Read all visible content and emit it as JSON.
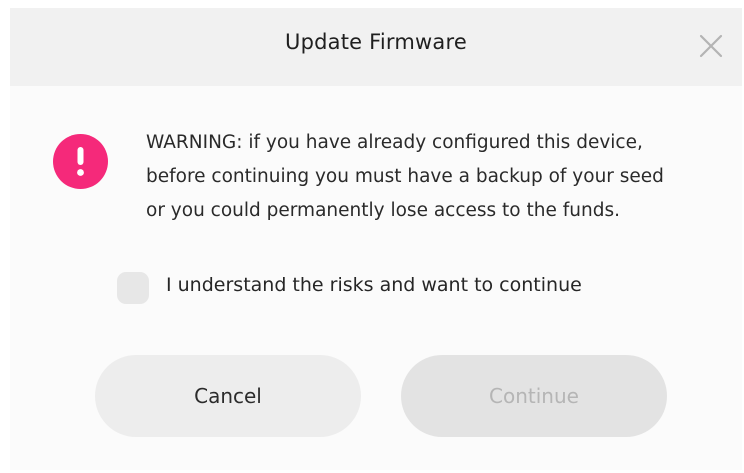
{
  "dialog": {
    "title": "Update Firmware",
    "close_icon": "close-icon"
  },
  "warning": {
    "icon": "exclamation-icon",
    "icon_color": "#f5297a",
    "lines": [
      "WARNING: if you have already configured this device,",
      "before continuing you must have a backup of your seed",
      "or you could permanently lose access to the funds."
    ]
  },
  "confirm": {
    "checked": false,
    "label": "I understand the risks and want to continue"
  },
  "buttons": {
    "cancel_label": "Cancel",
    "continue_label": "Continue",
    "continue_disabled": true
  }
}
